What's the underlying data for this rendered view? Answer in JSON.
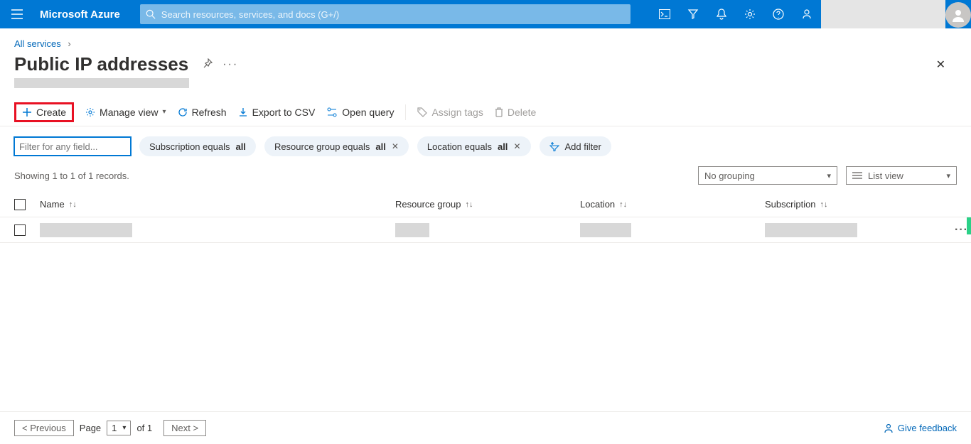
{
  "header": {
    "brand": "Microsoft Azure",
    "search_placeholder": "Search resources, services, and docs (G+/)"
  },
  "breadcrumb": {
    "parent": "All services"
  },
  "page": {
    "title": "Public IP addresses"
  },
  "toolbar": {
    "create": "Create",
    "manage_view": "Manage view",
    "refresh": "Refresh",
    "export_csv": "Export to CSV",
    "open_query": "Open query",
    "assign_tags": "Assign tags",
    "delete": "Delete"
  },
  "filters": {
    "input_placeholder": "Filter for any field...",
    "subscription": {
      "prefix": "Subscription equals ",
      "value": "all"
    },
    "resource_group": {
      "prefix": "Resource group equals ",
      "value": "all"
    },
    "location": {
      "prefix": "Location equals ",
      "value": "all"
    },
    "add_filter": "Add filter"
  },
  "results": {
    "summary": "Showing 1 to 1 of 1 records.",
    "grouping": "No grouping",
    "view": "List view"
  },
  "columns": {
    "name": "Name",
    "resource_group": "Resource group",
    "location": "Location",
    "subscription": "Subscription"
  },
  "pagination": {
    "previous": "< Previous",
    "page_label": "Page",
    "page_number": "1",
    "of_total": "of 1",
    "next": "Next >"
  },
  "footer": {
    "feedback": "Give feedback"
  }
}
